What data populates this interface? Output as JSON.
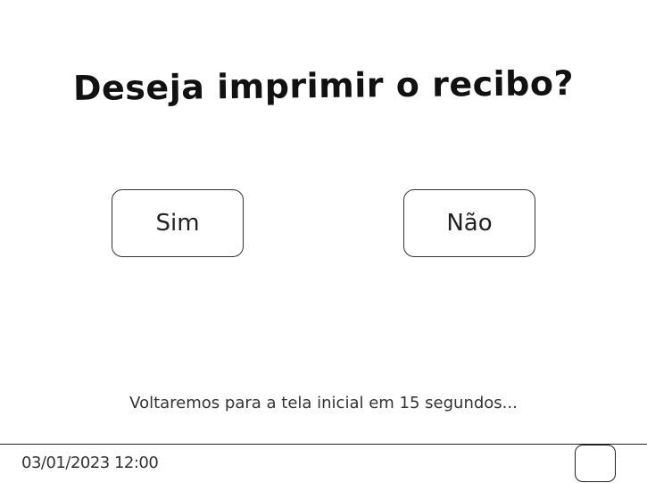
{
  "dialog": {
    "title": "Deseja imprimir o recibo?",
    "yes_label": "Sim",
    "no_label": "Não",
    "countdown_text": "Voltaremos para a tela inicial em 15 segundos..."
  },
  "footer": {
    "datetime": "03/01/2023 12:00"
  },
  "colors": {
    "text": "#111111",
    "border": "#333333",
    "background": "#ffffff"
  }
}
